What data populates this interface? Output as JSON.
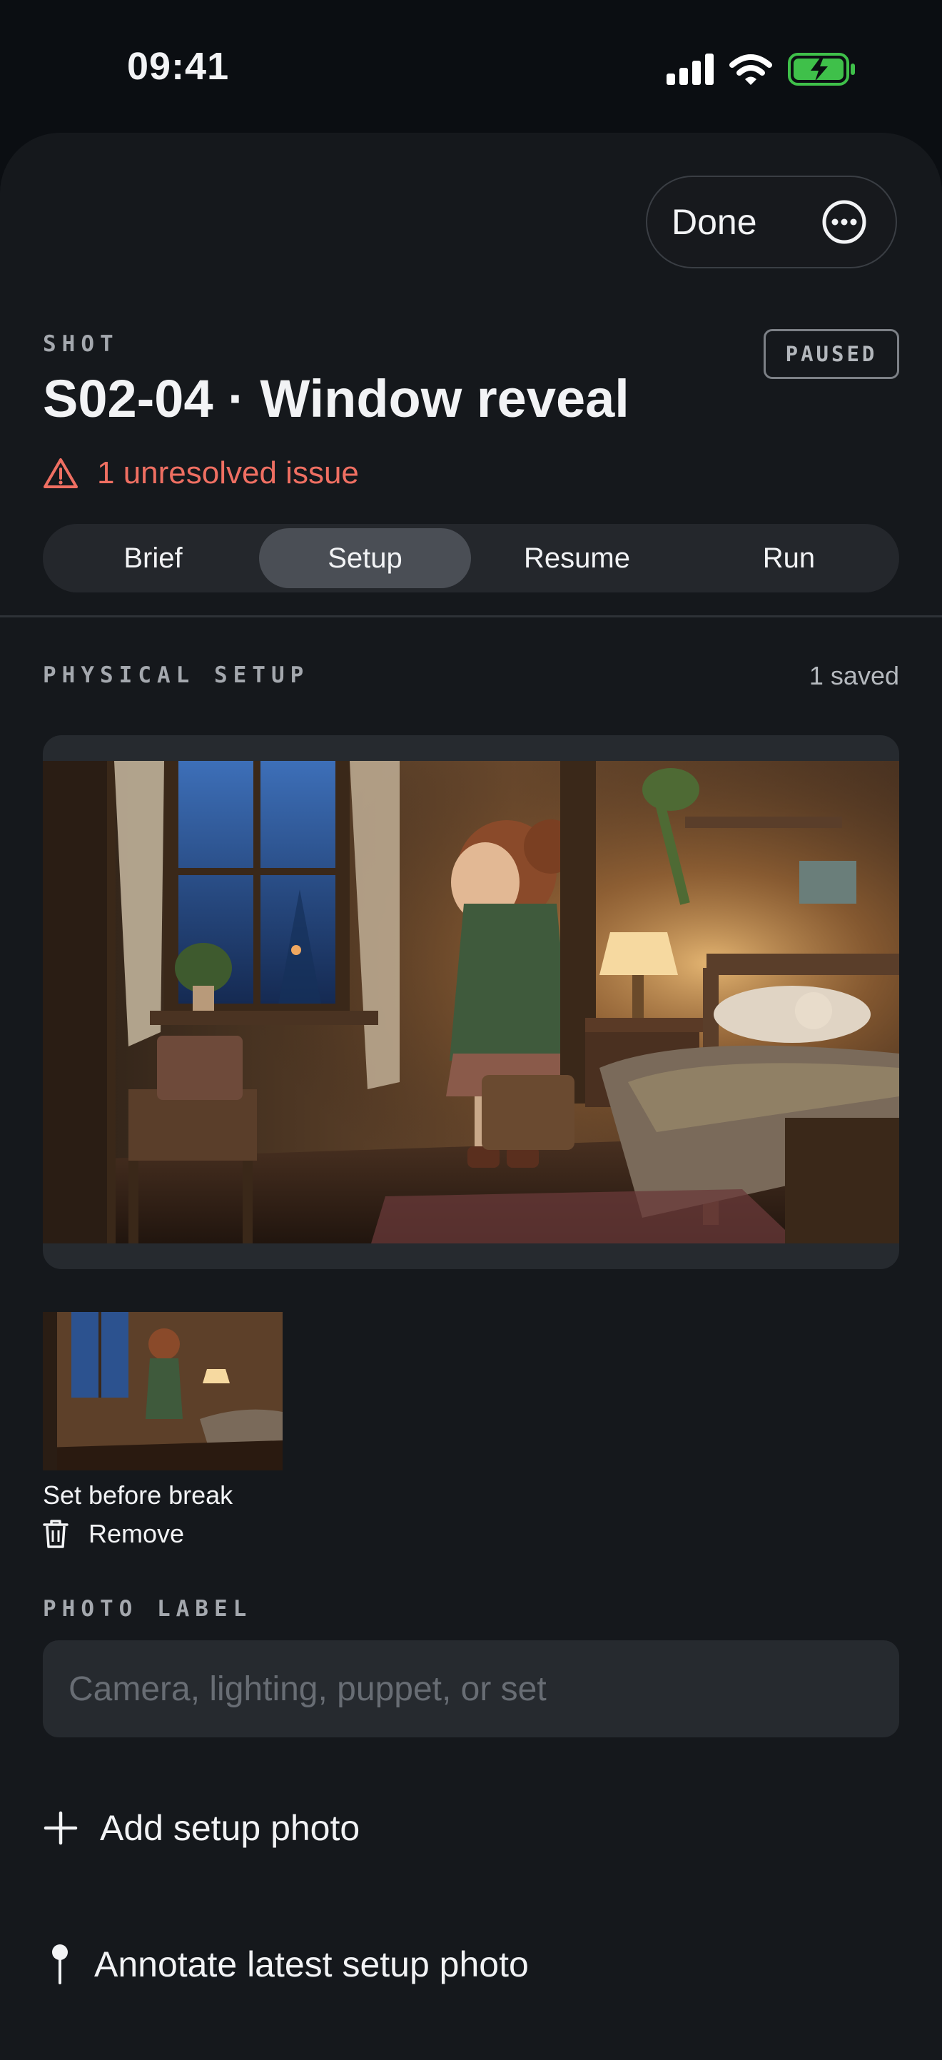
{
  "status_bar": {
    "time": "09:41"
  },
  "header": {
    "done_label": "Done"
  },
  "shot": {
    "eyebrow": "SHOT",
    "status_badge": "PAUSED",
    "title": "S02-04 · Window reveal",
    "issue_text": "1 unresolved issue"
  },
  "tabs": [
    {
      "label": "Brief",
      "active": false
    },
    {
      "label": "Setup",
      "active": true
    },
    {
      "label": "Resume",
      "active": false
    },
    {
      "label": "Run",
      "active": false
    }
  ],
  "physical_setup": {
    "section_label": "PHYSICAL SETUP",
    "saved_count": "1 saved",
    "thumbnail_caption": "Set before break",
    "remove_label": "Remove"
  },
  "photo_label": {
    "section_label": "PHOTO LABEL",
    "placeholder": "Camera, lighting, puppet, or set",
    "value": ""
  },
  "actions": {
    "add_photo": "Add setup photo",
    "annotate": "Annotate latest setup photo"
  },
  "colors": {
    "background": "#0b0e12",
    "sheet": "#15181c",
    "warning": "#ef6f62",
    "battery": "#3fc04a"
  },
  "icons": [
    "signal-icon",
    "wifi-icon",
    "battery-charging-icon",
    "more-icon",
    "warning-icon",
    "trash-icon",
    "plus-icon",
    "pin-icon"
  ]
}
